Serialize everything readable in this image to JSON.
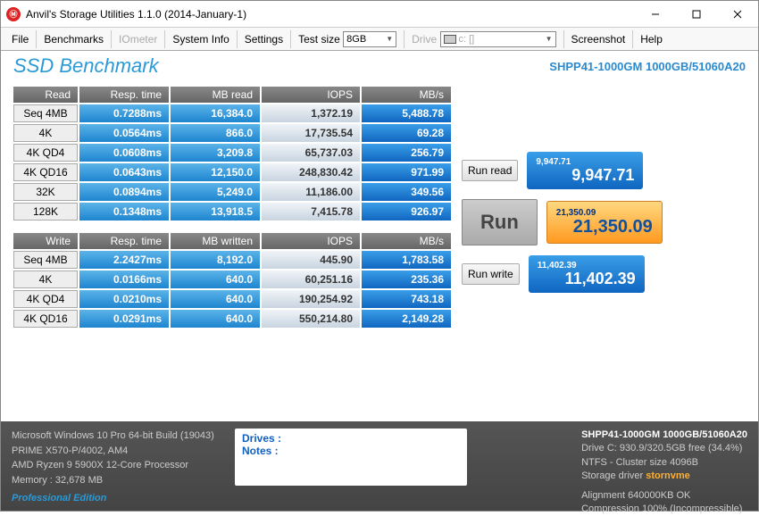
{
  "window": {
    "title": "Anvil's Storage Utilities 1.1.0 (2014-January-1)",
    "icon_glyph": "⌂"
  },
  "menu": {
    "file": "File",
    "benchmarks": "Benchmarks",
    "iometer": "IOmeter",
    "systeminfo": "System Info",
    "settings": "Settings",
    "testsize_label": "Test size",
    "testsize_value": "8GB",
    "drive_label": "Drive",
    "drive_value": "c: []",
    "screenshot": "Screenshot",
    "help": "Help"
  },
  "header": {
    "title": "SSD Benchmark",
    "device": "SHPP41-1000GM 1000GB/51060A20"
  },
  "read": {
    "header": [
      "Read",
      "Resp. time",
      "MB read",
      "IOPS",
      "MB/s"
    ],
    "rows": [
      {
        "label": "Seq 4MB",
        "resp": "0.7288ms",
        "mb": "16,384.0",
        "iops": "1,372.19",
        "rate": "5,488.78"
      },
      {
        "label": "4K",
        "resp": "0.0564ms",
        "mb": "866.0",
        "iops": "17,735.54",
        "rate": "69.28"
      },
      {
        "label": "4K QD4",
        "resp": "0.0608ms",
        "mb": "3,209.8",
        "iops": "65,737.03",
        "rate": "256.79"
      },
      {
        "label": "4K QD16",
        "resp": "0.0643ms",
        "mb": "12,150.0",
        "iops": "248,830.42",
        "rate": "971.99"
      },
      {
        "label": "32K",
        "resp": "0.0894ms",
        "mb": "5,249.0",
        "iops": "11,186.00",
        "rate": "349.56"
      },
      {
        "label": "128K",
        "resp": "0.1348ms",
        "mb": "13,918.5",
        "iops": "7,415.78",
        "rate": "926.97"
      }
    ]
  },
  "write": {
    "header": [
      "Write",
      "Resp. time",
      "MB written",
      "IOPS",
      "MB/s"
    ],
    "rows": [
      {
        "label": "Seq 4MB",
        "resp": "2.2427ms",
        "mb": "8,192.0",
        "iops": "445.90",
        "rate": "1,783.58"
      },
      {
        "label": "4K",
        "resp": "0.0166ms",
        "mb": "640.0",
        "iops": "60,251.16",
        "rate": "235.36"
      },
      {
        "label": "4K QD4",
        "resp": "0.0210ms",
        "mb": "640.0",
        "iops": "190,254.92",
        "rate": "743.18"
      },
      {
        "label": "4K QD16",
        "resp": "0.0291ms",
        "mb": "640.0",
        "iops": "550,214.80",
        "rate": "2,149.28"
      }
    ]
  },
  "buttons": {
    "run_read": "Run read",
    "run": "Run",
    "run_write": "Run write"
  },
  "scores": {
    "read_small": "9,947.71",
    "read_big": "9,947.71",
    "total_small": "21,350.09",
    "total_big": "21,350.09",
    "write_small": "11,402.39",
    "write_big": "11,402.39"
  },
  "footer": {
    "sys": [
      "Microsoft Windows 10 Pro 64-bit Build (19043)",
      "PRIME X570-P/4002, AM4",
      "AMD Ryzen 9 5900X 12-Core Processor",
      "Memory : 32,678 MB"
    ],
    "edition": "Professional Edition",
    "notes_drives": "Drives :",
    "notes_label": "Notes :",
    "drv": {
      "model": "SHPP41-1000GM 1000GB/51060A20",
      "free": "Drive C: 930.9/320.5GB free (34.4%)",
      "fs": "NTFS - Cluster size 4096B",
      "driver_label": "Storage driver",
      "driver_value": "stornvme",
      "align": "Alignment 640000KB OK",
      "comp": "Compression 100% (Incompressible)"
    }
  }
}
